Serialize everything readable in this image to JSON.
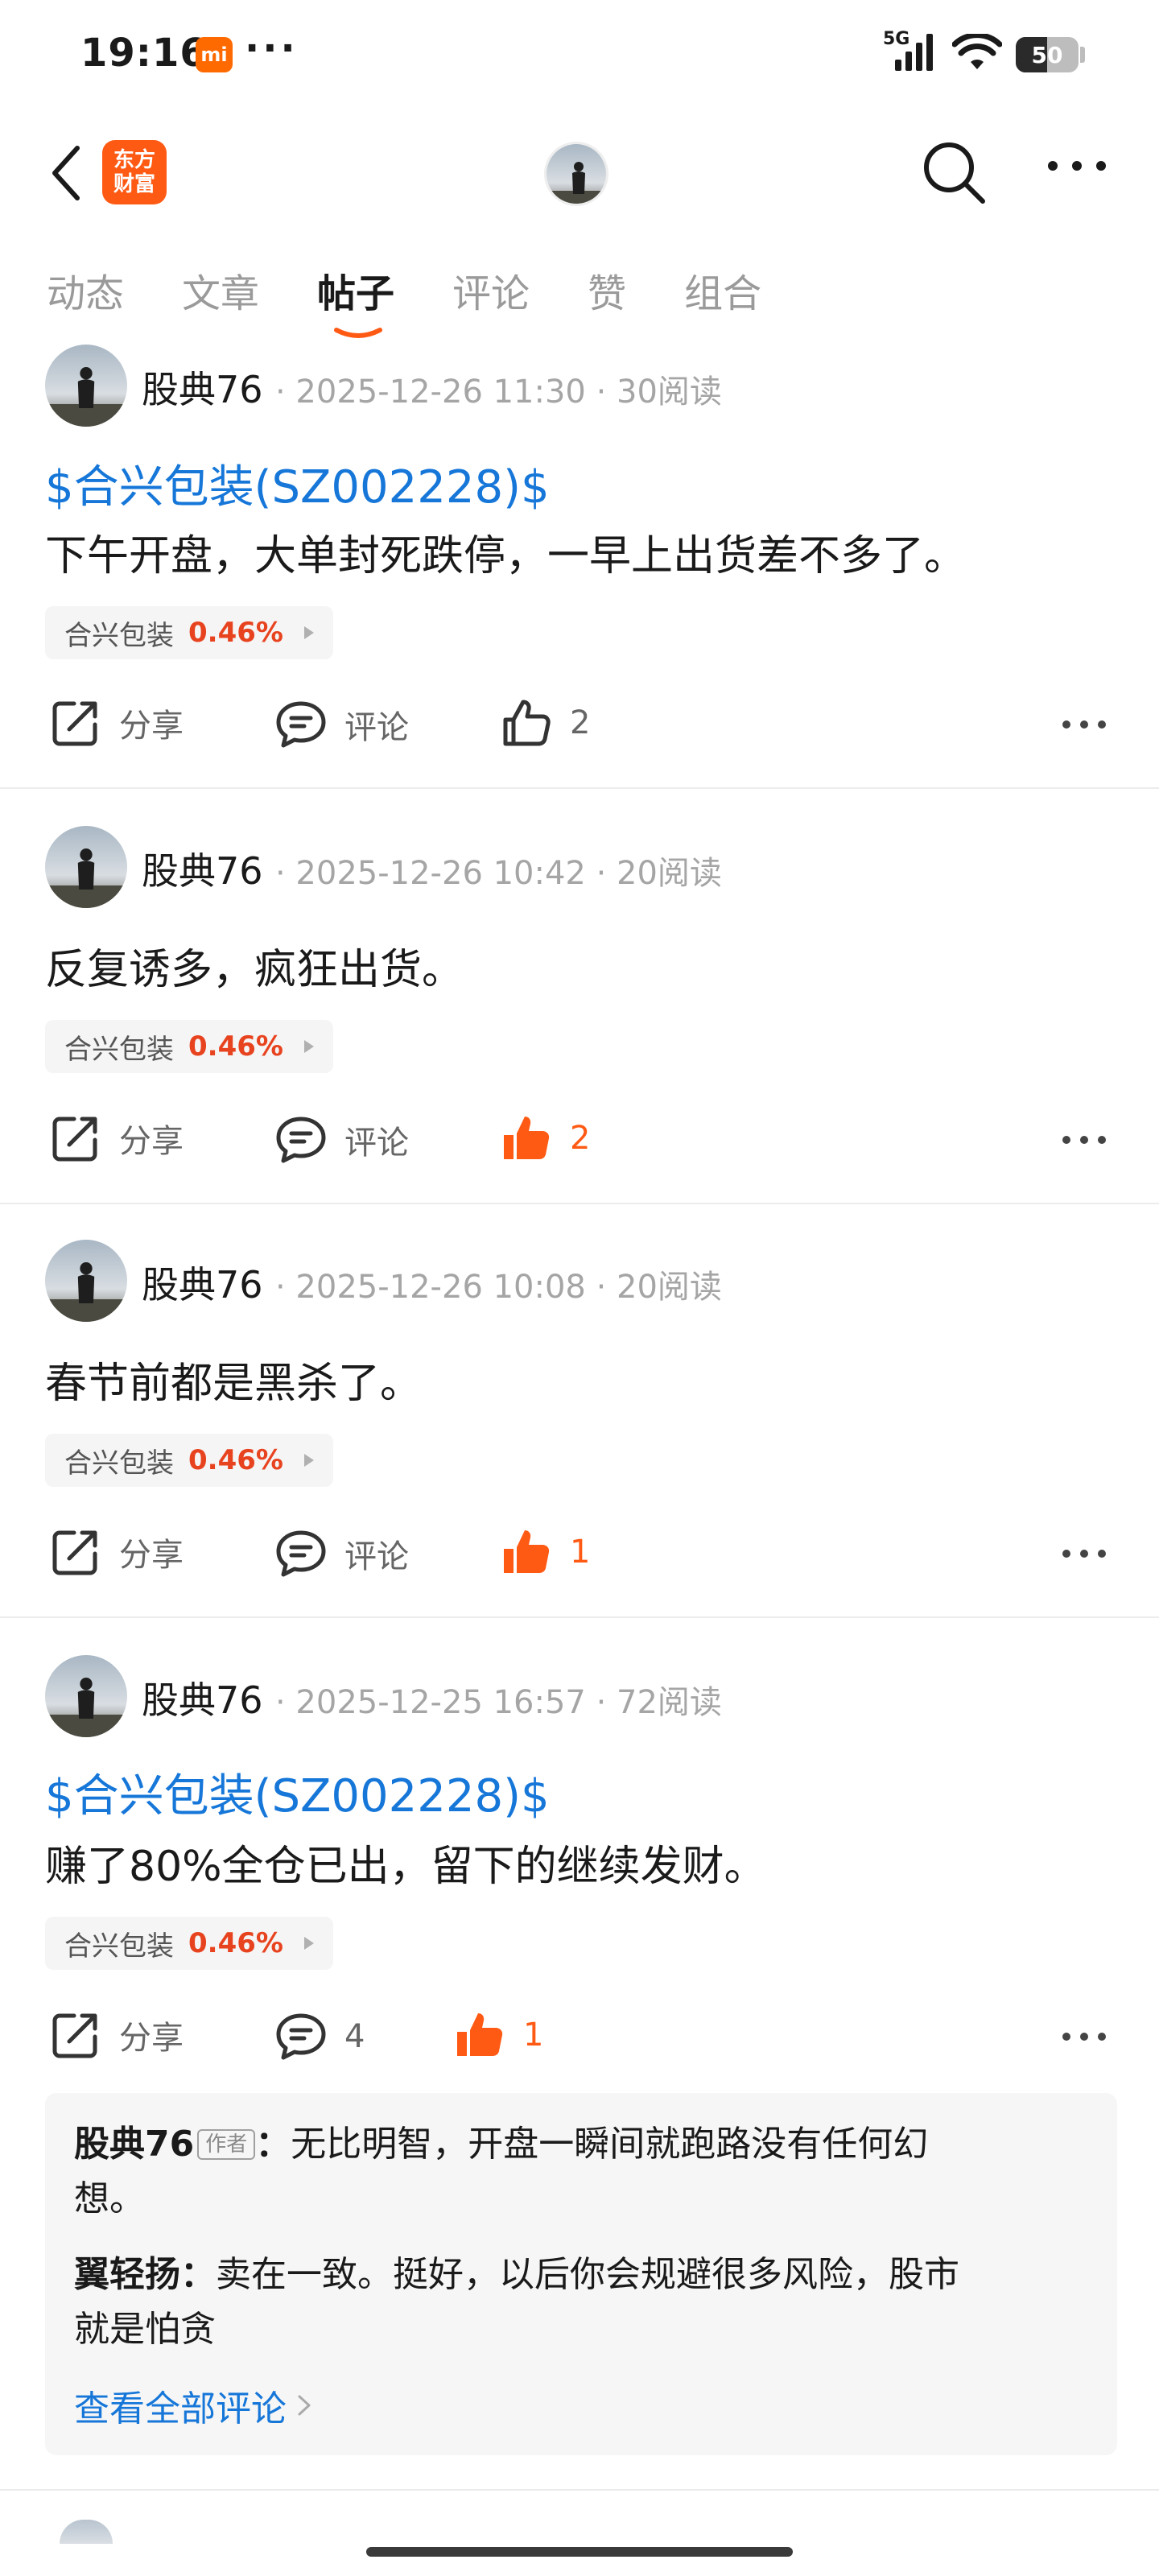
{
  "status_bar": {
    "time": "19:16",
    "mi_badge": "mi",
    "dots": "···",
    "network": "5G",
    "battery": "50",
    "battery_level_pct": 50
  },
  "nav": {
    "logo_line1": "东方",
    "logo_line2": "财富"
  },
  "tabs": [
    {
      "label": "动态",
      "active": false
    },
    {
      "label": "文章",
      "active": false
    },
    {
      "label": "帖子",
      "active": true
    },
    {
      "label": "评论",
      "active": false
    },
    {
      "label": "赞",
      "active": false
    },
    {
      "label": "组合",
      "active": false
    }
  ],
  "posts": [
    {
      "author": "股典76",
      "meta": "· 2025-12-26 11:30 · 30阅读",
      "stock_link": "$合兴包装(SZ002228)$",
      "body": "下午开盘，大单封死跌停，一早上出货差不多了。",
      "chip_name": "合兴包装",
      "chip_pct": "0.46%",
      "share_label": "分享",
      "comment_label": "评论",
      "like_count": "2",
      "liked": false
    },
    {
      "author": "股典76",
      "meta": "· 2025-12-26 10:42 · 20阅读",
      "stock_link": "",
      "body": "反复诱多，疯狂出货。",
      "chip_name": "合兴包装",
      "chip_pct": "0.46%",
      "share_label": "分享",
      "comment_label": "评论",
      "like_count": "2",
      "liked": true
    },
    {
      "author": "股典76",
      "meta": "· 2025-12-26 10:08 · 20阅读",
      "stock_link": "",
      "body": "春节前都是黑杀了。",
      "chip_name": "合兴包装",
      "chip_pct": "0.46%",
      "share_label": "分享",
      "comment_label": "评论",
      "like_count": "1",
      "liked": true
    },
    {
      "author": "股典76",
      "meta": "· 2025-12-25 16:57 · 72阅读",
      "stock_link": "$合兴包装(SZ002228)$",
      "body": "赚了80%全仓已出，留下的继续发财。",
      "chip_name": "合兴包装",
      "chip_pct": "0.46%",
      "share_label": "分享",
      "comment_label": "4",
      "like_count": "1",
      "liked": true
    }
  ],
  "comments": [
    {
      "name": "股典76",
      "tag": "作者",
      "colon": "：",
      "text_line1": "无比明智，开盘一瞬间就跑路没有任何幻",
      "text_line2": "想。"
    },
    {
      "name": "翼轻扬",
      "tag": "",
      "colon": "：",
      "text_line1": "卖在一致。挺好，以后你会规避很多风险，股市",
      "text_line2": "就是怕贪"
    }
  ],
  "view_all_comments": "查看全部评论",
  "colors": {
    "accent_orange": "#ff5a14",
    "link_blue": "#1677d9",
    "pct_red": "#e8431f"
  }
}
